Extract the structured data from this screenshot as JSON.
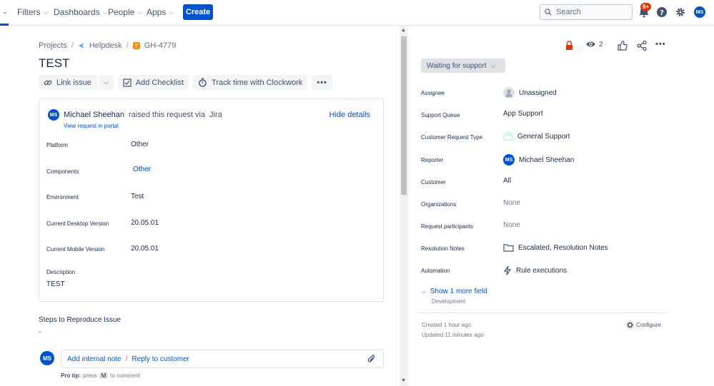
{
  "nav": {
    "items": [
      "Filters",
      "Dashboards",
      "People",
      "Apps"
    ],
    "create_label": "Create",
    "search_placeholder": "Search",
    "notification_badge": "9+",
    "user_initials": "MS"
  },
  "breadcrumb": {
    "projects": "Projects",
    "project": "Helpdesk",
    "issue_key": "GH-4779"
  },
  "issue": {
    "title": "TEST"
  },
  "toolbar": {
    "link_issue": "Link issue",
    "add_checklist": "Add Checklist",
    "track_time": "Track time with Clockwork"
  },
  "request": {
    "raiser_initials": "MS",
    "raiser_name": "Michael Sheehan",
    "raised_text": "raised this request via",
    "channel": "Jira",
    "hide_details": "Hide details",
    "view_portal": "View request in portal",
    "fields": [
      {
        "label": "Platform",
        "value": "Other"
      },
      {
        "label": "Components",
        "value": "Other"
      },
      {
        "label": "Environment",
        "value": "Test"
      },
      {
        "label": "Current Desktop Version",
        "value": "20.05.01"
      },
      {
        "label": "Current Mobile Version",
        "value": "20.05.01"
      }
    ],
    "description_label": "Description",
    "description_value": "TEST"
  },
  "steps": {
    "label": "Steps to Reproduce Issue",
    "value": "-"
  },
  "comment": {
    "avatar_initials": "MS",
    "add_internal_note": "Add internal note",
    "separator": "/",
    "reply_to_customer": "Reply to customer",
    "pro_tip_label": "Pro tip:",
    "pro_tip_text_1": "press",
    "pro_tip_key": "M",
    "pro_tip_text_2": "to comment"
  },
  "sidebar": {
    "watchers_count": "2",
    "status": "Waiting for support",
    "fields": [
      {
        "label": "Assignee",
        "value": "Unassigned"
      },
      {
        "label": "Support Queue",
        "value": "App Support"
      },
      {
        "label": "Customer Request Type",
        "value": "General Support"
      },
      {
        "label": "Reporter",
        "value": "Michael Sheehan",
        "initials": "MS"
      },
      {
        "label": "Customer",
        "value": "All"
      },
      {
        "label": "Organizations",
        "value": "None"
      },
      {
        "label": "Request participants",
        "value": "None"
      },
      {
        "label": "Resolution Notes",
        "value": "Escalated, Resolution Notes"
      },
      {
        "label": "Automation",
        "value": "Rule executions"
      }
    ],
    "show_more": "Show 1 more field",
    "show_more_sub": "Development",
    "created": "Created 1 hour ago",
    "updated": "Updated 11 minutes ago",
    "configure": "Configure"
  },
  "colors": {
    "brand_blue": "#0052cc",
    "badge_red": "#de350b",
    "lock_red": "#de350b"
  }
}
